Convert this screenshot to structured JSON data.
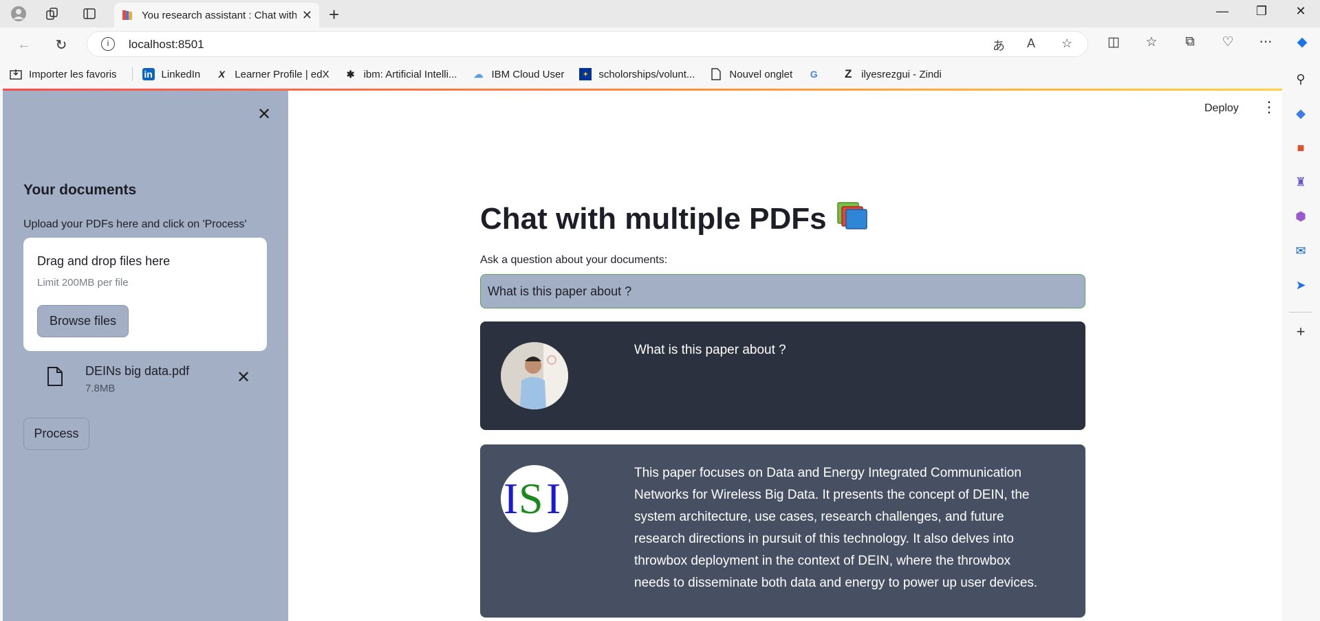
{
  "browser": {
    "tab_title": "You research assistant : Chat with",
    "url": "localhost:8501",
    "bookmarks": [
      {
        "label": "Importer les favoris",
        "icon": "import-icon"
      },
      {
        "label": "LinkedIn",
        "icon": "linkedin-icon"
      },
      {
        "label": "Learner Profile | edX",
        "icon": "edx-icon"
      },
      {
        "label": "ibm: Artificial Intelli...",
        "icon": "bee-icon"
      },
      {
        "label": "IBM Cloud User",
        "icon": "cloud-icon"
      },
      {
        "label": "scholorships/volunt...",
        "icon": "eu-flag-icon"
      },
      {
        "label": "Nouvel onglet",
        "icon": "page-icon"
      },
      {
        "label": "",
        "icon": "google-icon"
      },
      {
        "label": "ilyesrezgui - Zindi",
        "icon": "zindi-icon"
      }
    ]
  },
  "sidebar": {
    "heading": "Your documents",
    "instruction": "Upload your PDFs here and click on 'Process'",
    "uploader": {
      "title": "Drag and drop files here",
      "limit": "Limit 200MB per file",
      "browse_label": "Browse files"
    },
    "file": {
      "name": "DEINs big data.pdf",
      "size": "7.8MB"
    },
    "process_label": "Process"
  },
  "header": {
    "deploy_label": "Deploy"
  },
  "main": {
    "title": "Chat with multiple PDFs",
    "question_label": "Ask a question about your documents:",
    "question_value": "What is this paper about ?",
    "messages": [
      {
        "role": "user",
        "text": "What is this paper about ?"
      },
      {
        "role": "bot",
        "avatar_text": "ISI",
        "text": "This paper focuses on Data and Energy Integrated Communication Networks for Wireless Big Data. It presents the concept of DEIN, the system architecture, use cases, research challenges, and future research directions in pursuit of this technology. It also delves into throwbox deployment in the context of DEIN, where the throwbox needs to disseminate both data and energy to power up user devices."
      }
    ]
  },
  "colors": {
    "sidebar_bg": "#a3afc4",
    "user_msg_bg": "#2b313e",
    "bot_msg_bg": "#475063",
    "accent": "#ff4b4b"
  }
}
